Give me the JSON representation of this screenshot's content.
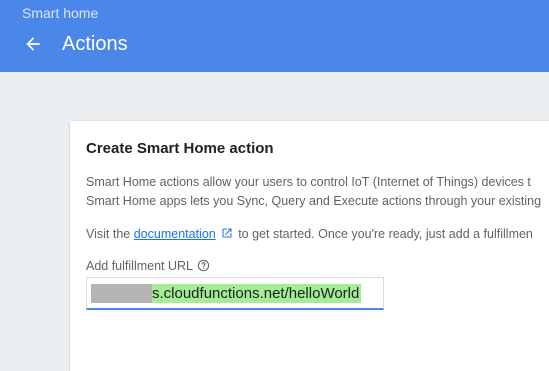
{
  "header": {
    "breadcrumb": "Smart home",
    "title": "Actions",
    "back_icon": "arrow-back-icon",
    "background_color": "#4a87e8"
  },
  "card": {
    "title": "Create Smart Home action",
    "description_line_1": "Smart Home actions allow your users to control IoT (Internet of Things) devices t",
    "description_line_2": "Smart Home apps lets you Sync, Query and Execute actions through your existing",
    "visit_prefix": "Visit the ",
    "documentation_link": "documentation",
    "open_in_new_icon": "open-in-new-icon",
    "visit_suffix": " to get started. Once you're ready, just add a fulfillmen",
    "fulfillment_label": "Add fulfillment URL",
    "help_icon": "help-circle-icon",
    "fulfillment_url_value": "s.cloudfunctions.net/helloWorld",
    "accent_color": "#4a87e8",
    "highlight_color": "#a4ec95"
  }
}
